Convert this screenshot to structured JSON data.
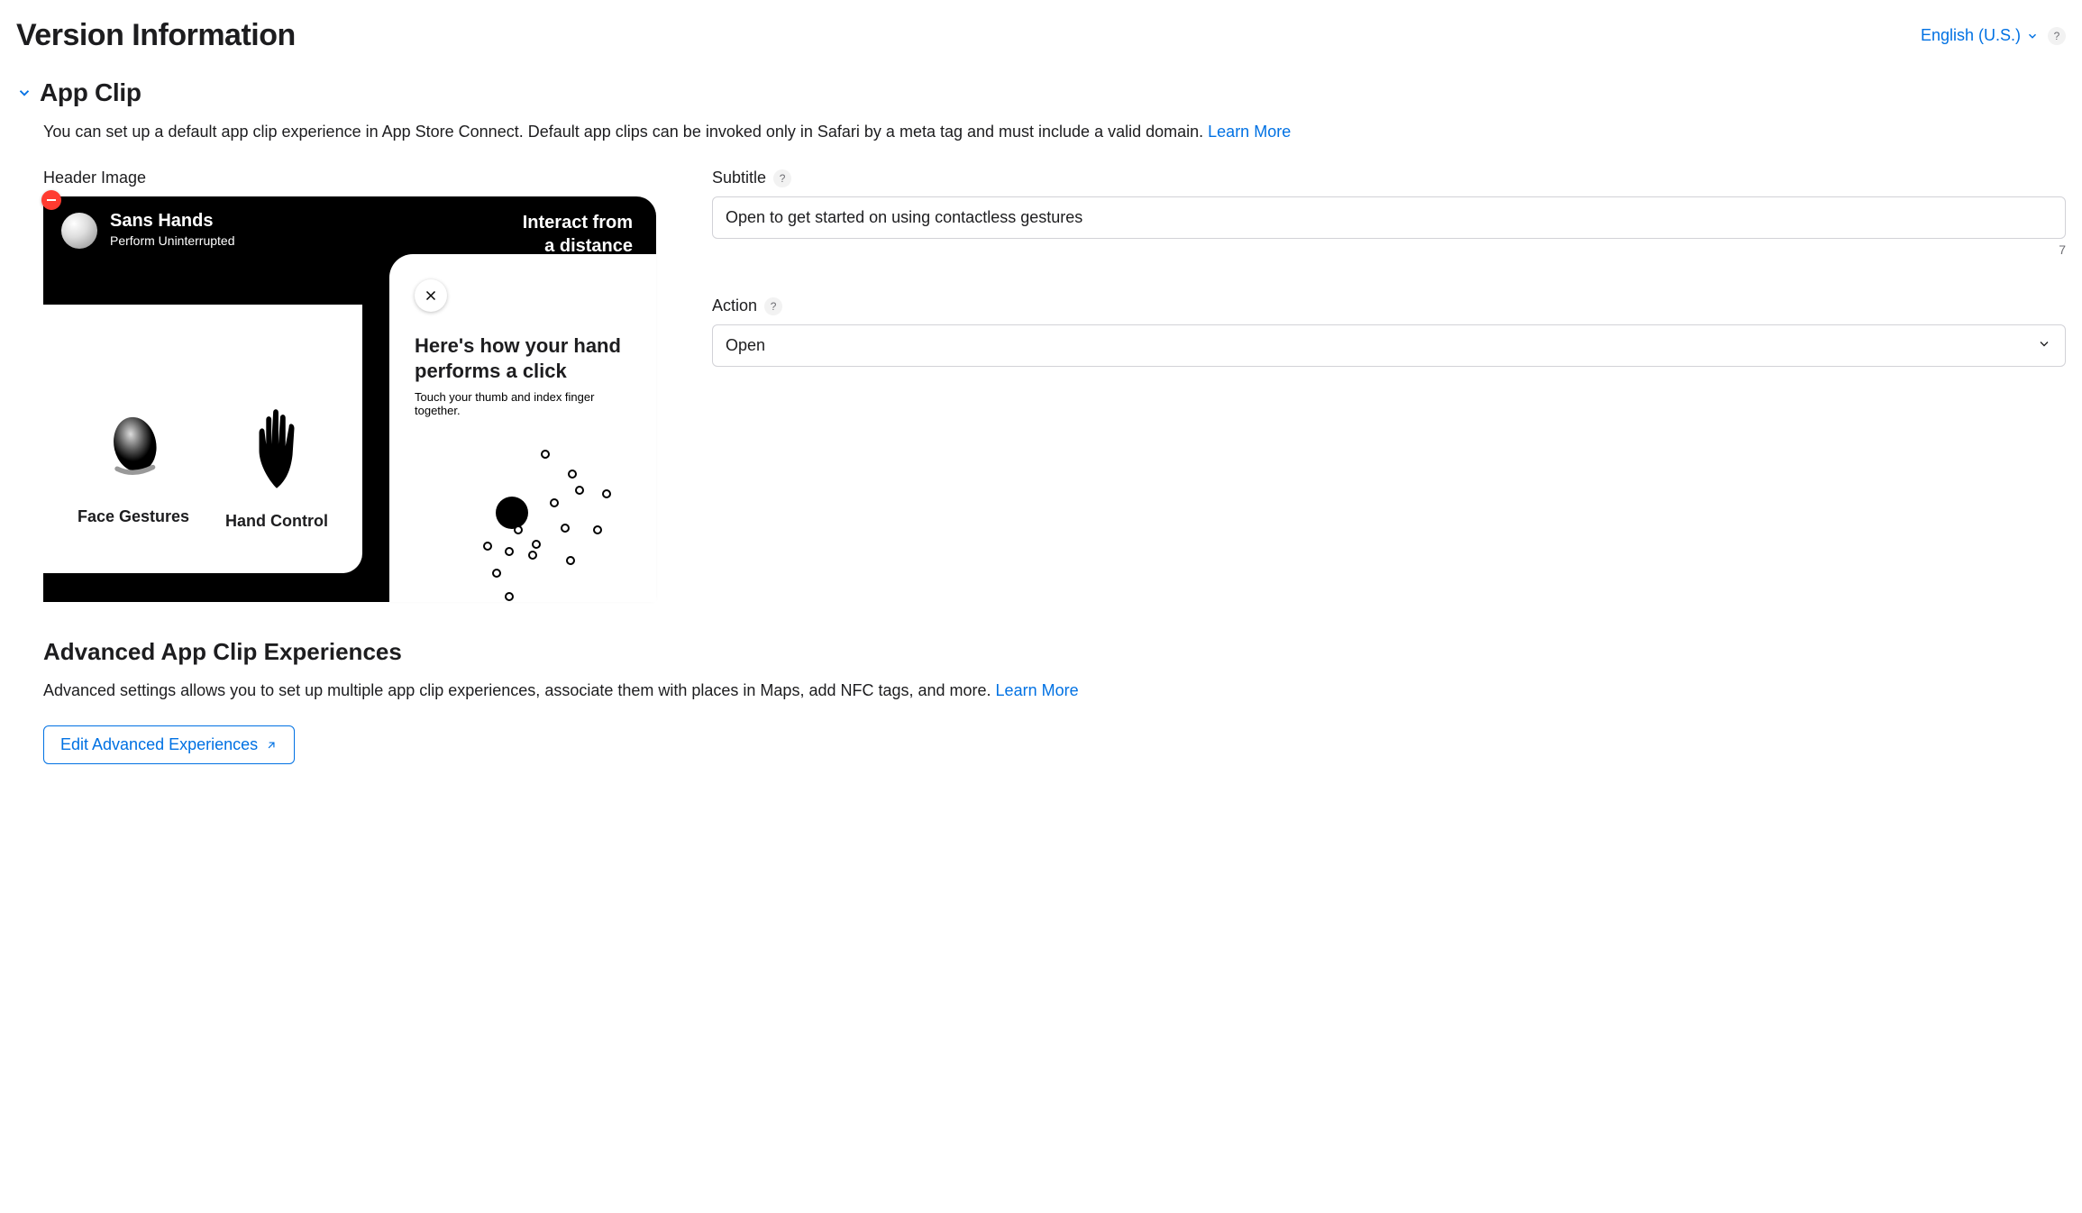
{
  "header": {
    "page_title": "Version Information",
    "language": "English (U.S.)"
  },
  "app_clip": {
    "section_title": "App Clip",
    "description": "You can set up a default app clip experience in App Store Connect. Default app clips can be invoked only in Safari by a meta tag and must include a valid domain. ",
    "learn_more": "Learn More",
    "header_image_label": "Header Image",
    "subtitle_label": "Subtitle",
    "subtitle_value": "Open to get started on using contactless gestures",
    "subtitle_remaining": "7",
    "action_label": "Action",
    "action_value": "Open",
    "preview": {
      "app_name": "Sans Hands",
      "app_subtitle": "Perform Uninterrupted",
      "tagline_line1": "Interact from",
      "tagline_line2": "a distance",
      "gesture_face": "Face Gestures",
      "gesture_hand": "Hand Control",
      "panel_heading": "Here's how your hand performs a click",
      "panel_sub": "Touch your thumb and index finger together."
    }
  },
  "advanced": {
    "title": "Advanced App Clip Experiences",
    "description": "Advanced settings allows you to set up multiple app clip experiences, associate them with places in Maps, add NFC tags, and more. ",
    "learn_more": "Learn More",
    "button_label": "Edit Advanced Experiences"
  }
}
